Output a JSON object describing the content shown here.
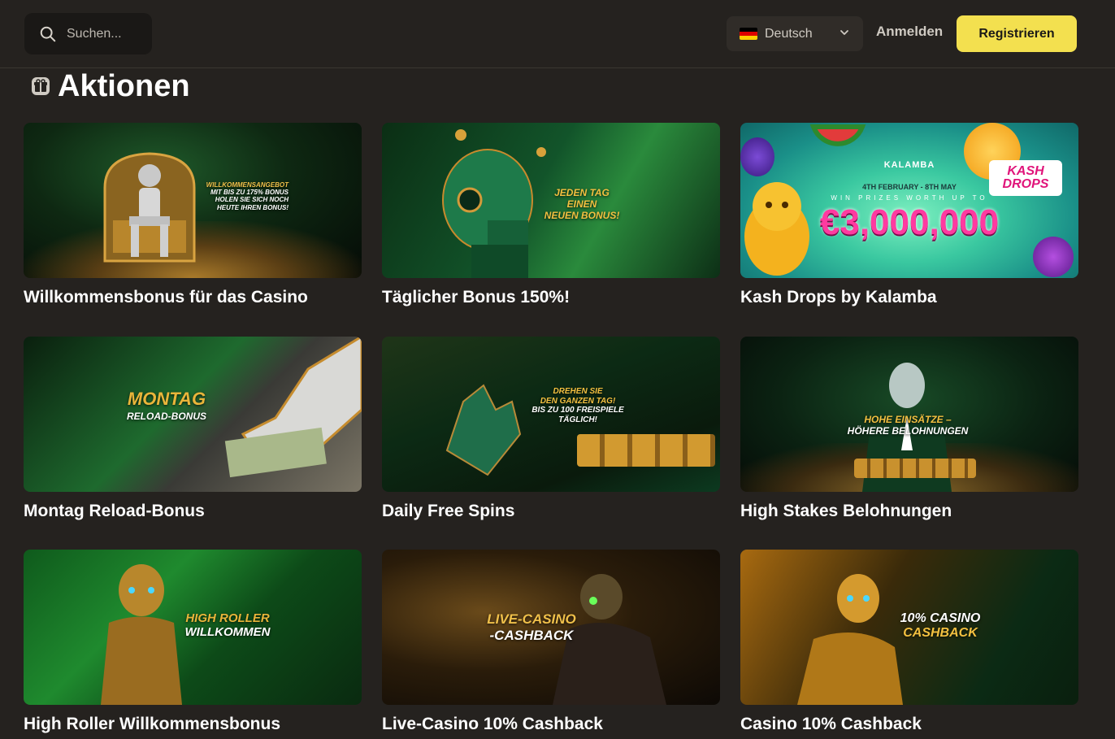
{
  "header": {
    "search_placeholder": "Suchen...",
    "language": "Deutsch",
    "login_label": "Anmelden",
    "register_label": "Registrieren"
  },
  "page": {
    "title": "Aktionen"
  },
  "promotions": [
    {
      "title": "Willkommensbonus für das Casino",
      "banner": [
        "WILLKOMMENSANGEBOT",
        "MIT BIS ZU 175% BONUS",
        "HOLEN SIE SICH NOCH",
        "HEUTE IHREN BONUS!"
      ]
    },
    {
      "title": "Täglicher Bonus 150%!",
      "banner": [
        "JEDEN TAG EINEN",
        "NEUEN BONUS!"
      ]
    },
    {
      "title": "Kash Drops by Kalamba",
      "banner": [
        "KALAMBA",
        "4TH FEBRUARY - 8TH MAY",
        "WIN PRIZES WORTH UP TO",
        "€3,000,000",
        "KASH DROPS"
      ]
    },
    {
      "title": "Montag Reload-Bonus",
      "banner": [
        "MONTAG",
        "RELOAD-BONUS"
      ]
    },
    {
      "title": "Daily Free Spins",
      "banner": [
        "DREHEN SIE",
        "DEN GANZEN TAG!",
        "BIS ZU 100 FREISPIELE",
        "TÄGLICH!"
      ]
    },
    {
      "title": "High Stakes Belohnungen",
      "banner": [
        "HOHE EINSÄTZE –",
        "HÖHERE BELOHNUNGEN"
      ]
    },
    {
      "title": "High Roller Willkommensbonus",
      "banner": [
        "HIGH ROLLER",
        "WILLKOMMEN"
      ]
    },
    {
      "title": "Live-Casino 10% Cashback",
      "banner": [
        "LIVE-CASINO",
        "-CASHBACK"
      ]
    },
    {
      "title": "Casino 10% Cashback",
      "banner": [
        "10% CASINO",
        "CASHBACK"
      ]
    }
  ],
  "colors": {
    "background": "#25221f",
    "accent_yellow": "#f3e04f",
    "banner_gold": "#e8b33a",
    "kash_pink": "#e0147a"
  }
}
